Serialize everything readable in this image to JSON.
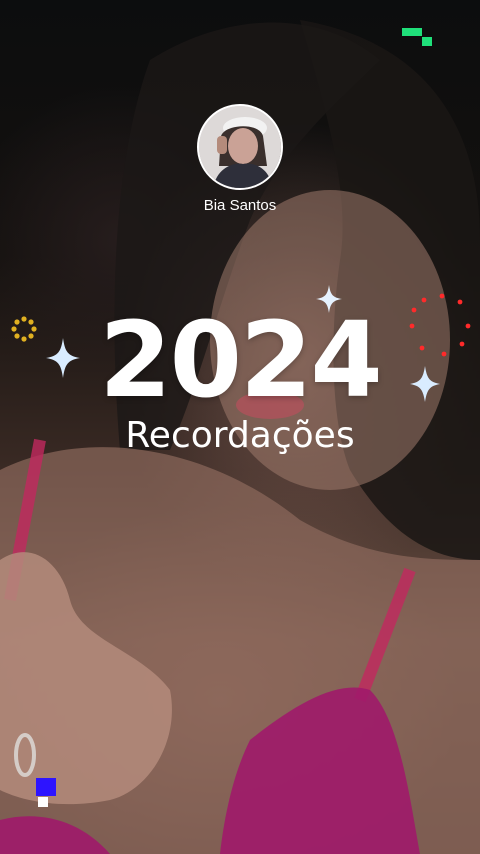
{
  "profile": {
    "name": "Bia Santos",
    "avatar_icon": "profile-photo"
  },
  "title": {
    "year": "2024",
    "subtitle": "Recordações"
  },
  "colors": {
    "text": "#ffffff",
    "sparkle": "#d9ecff",
    "ring_dots": "#e0b021",
    "heart_dots": "#ff2a2a",
    "pixel_green": "#1fe07a",
    "pixel_blue": "#2d14ff"
  },
  "decorations": [
    "sparkle-icon",
    "sun-ring-icon",
    "heart-dots-icon",
    "pixel-blocks-icon"
  ]
}
